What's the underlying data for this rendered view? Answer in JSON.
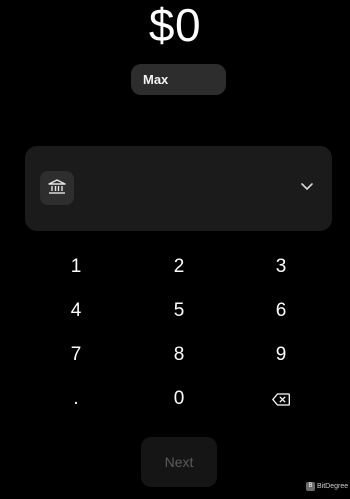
{
  "amount": "$0",
  "max_label": "Max",
  "account_select": {
    "icon": "bank-icon",
    "chevron_icon": "chevron-down-icon"
  },
  "keypad": {
    "k1": "1",
    "k2": "2",
    "k3": "3",
    "k4": "4",
    "k5": "5",
    "k6": "6",
    "k7": "7",
    "k8": "8",
    "k9": "9",
    "kdot": ".",
    "k0": "0",
    "backspace_icon": "backspace-icon"
  },
  "next_label": "Next",
  "watermark": {
    "badge": "B",
    "text": "BitDegree"
  },
  "colors": {
    "background": "#000000",
    "card": "#1b1b1b",
    "max_button": "#2d2d2d",
    "next_disabled_bg": "#151515",
    "next_disabled_text": "#5a5a5a"
  }
}
